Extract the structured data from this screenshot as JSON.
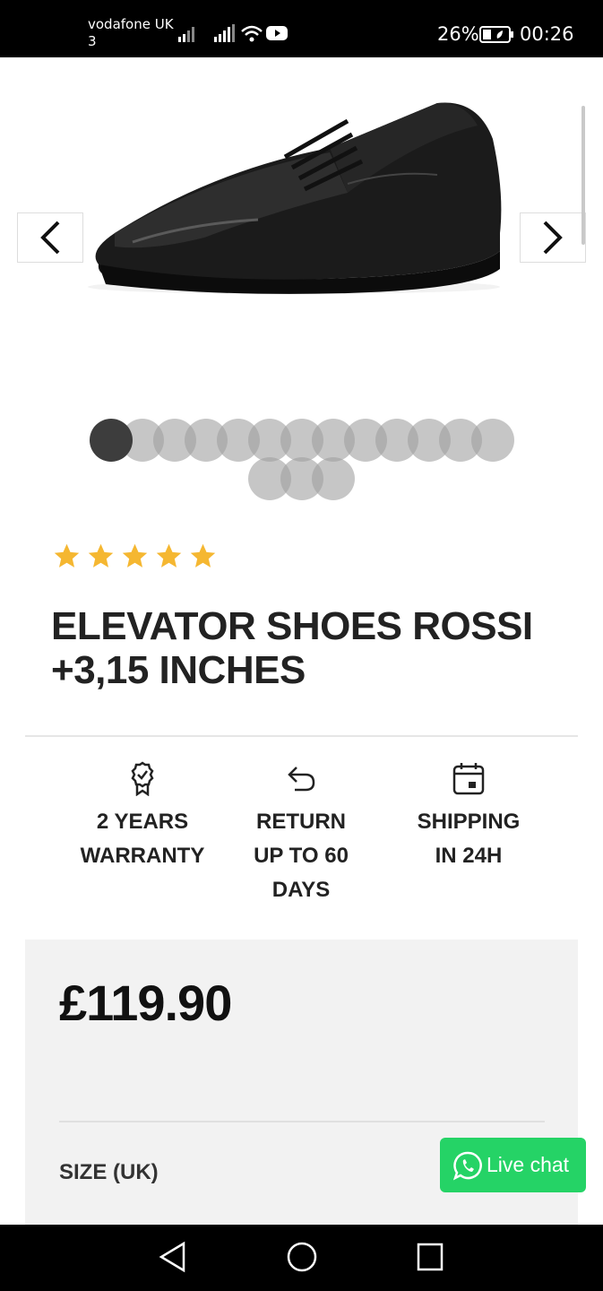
{
  "status_bar": {
    "carrier_line1": "vodafone UK",
    "carrier_line2": "3",
    "battery_percent": "26%",
    "time": "00:26"
  },
  "gallery": {
    "prev_icon": "chevron-left-icon",
    "next_icon": "chevron-right-icon",
    "total_images": 16,
    "active_index": 0
  },
  "product": {
    "rating_stars": 5,
    "title_line1": "ELEVATOR SHOES ROSSI",
    "title_line2": "+3,15 INCHES",
    "features": [
      {
        "icon": "award-badge-icon",
        "lines": [
          "2 YEARS",
          "WARRANTY"
        ]
      },
      {
        "icon": "return-arrow-icon",
        "lines": [
          "RETURN",
          "UP TO 60",
          "DAYS"
        ]
      },
      {
        "icon": "calendar-icon",
        "lines": [
          "SHIPPING",
          "IN 24H"
        ]
      }
    ],
    "price": "£119.90",
    "size_label": "SIZE (UK)"
  },
  "live_chat": {
    "label": "Live chat",
    "icon": "whatsapp-icon",
    "color": "#25d366"
  },
  "colors": {
    "star": "#f5b731",
    "active_dot": "#3d3d3d",
    "panel_bg": "#f2f2f2"
  }
}
